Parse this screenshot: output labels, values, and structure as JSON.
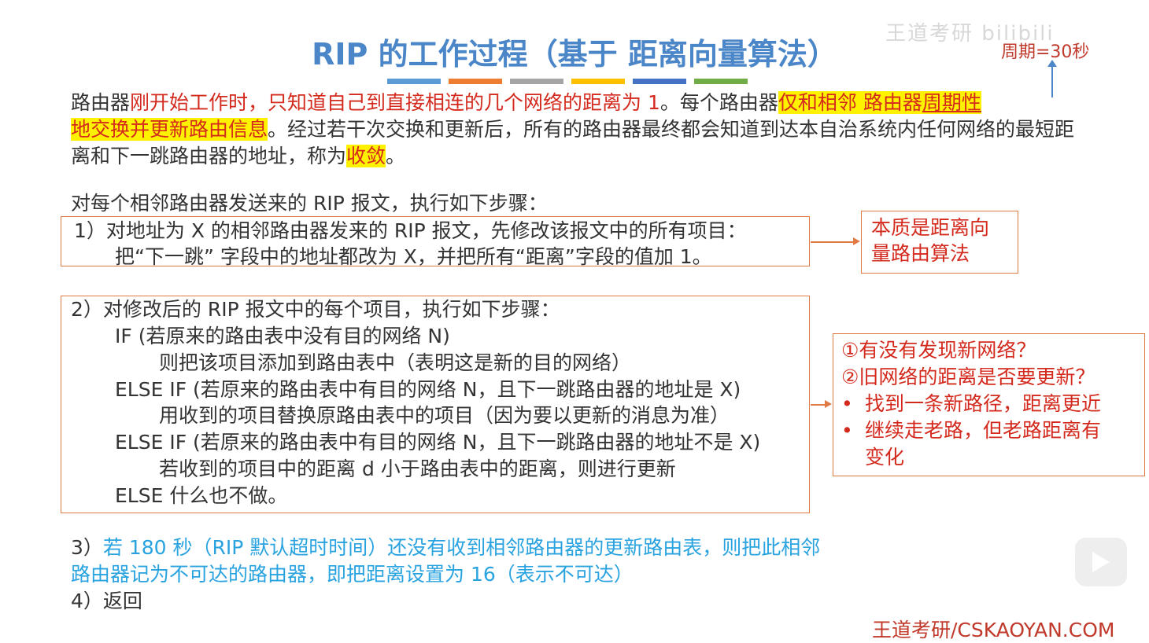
{
  "title": "RIP 的工作过程（基于 距离向量算法）",
  "period_note": "周期=30秒",
  "watermark": "王道考研 bilibili",
  "bar_colors": [
    "#5b9bd5",
    "#ed7d31",
    "#a5a5a5",
    "#ffc000",
    "#4472c4",
    "#70ad47"
  ],
  "intro": {
    "p1": "路由器",
    "p2_red": "刚开始工作时，只知道自己到直接相连的几个网络的距离为 1",
    "p3": "。每个路由器",
    "p4_hl": "仅和相邻 路由器",
    "p5_hl_ul": "周期性",
    "p6_hl": "地交换并更新路由信息",
    "p7": "。经过若干次交换和更新后，所有的路由器最终都会知道到达本自治系统内任何网络的最短距离和下一跳路由器的地址，称为",
    "p8_hl_red": "收敛",
    "p9": "。"
  },
  "steps_intro": "对每个相邻路由器发送来的 RIP 报文，执行如下步骤：",
  "step1": {
    "line1": "1）对地址为 X 的相邻路由器发来的 RIP 报文，先修改该报文中的所有项目：",
    "line2": "把“下一跳” 字段中的地址都改为 X，并把所有“距离”字段的值加 1。"
  },
  "step1_note": {
    "line1": "本质是距离向",
    "line2": "量路由算法"
  },
  "step2": {
    "line1": "2）对修改后的 RIP 报文中的每个项目，执行如下步骤：",
    "line2": "IF (若原来的路由表中没有目的网络 N)",
    "line3": "则把该项目添加到路由表中（表明这是新的目的网络）",
    "line4": "ELSE IF (若原来的路由表中有目的网络 N，且下一跳路由器的地址是 X)",
    "line5": "用收到的项目替换原路由表中的项目（因为要以更新的消息为准）",
    "line6": "ELSE IF (若原来的路由表中有目的网络 N，且下一跳路由器的地址不是 X)",
    "line7": "若收到的项目中的距离 d 小于路由表中的距离，则进行更新",
    "line8": "ELSE 什么也不做。"
  },
  "step2_note": {
    "q1": "①有没有发现新网络？",
    "q2": "②旧网络的距离是否要更新？",
    "b1": "找到一条新路径，距离更近",
    "b2a": "继续走老路，但老路距离有",
    "b2b": "变化"
  },
  "step3": {
    "prefix": "3）",
    "text1": "若 180 秒（RIP 默认超时时间）还没有收到相邻路由器的更新路由表，则把此相邻",
    "text2": "路由器记为不可达的路由器，即把距离设置为 16（表示不可达）"
  },
  "step4": "4）返回",
  "brand": "王道考研/CSKAOYAN.COM"
}
